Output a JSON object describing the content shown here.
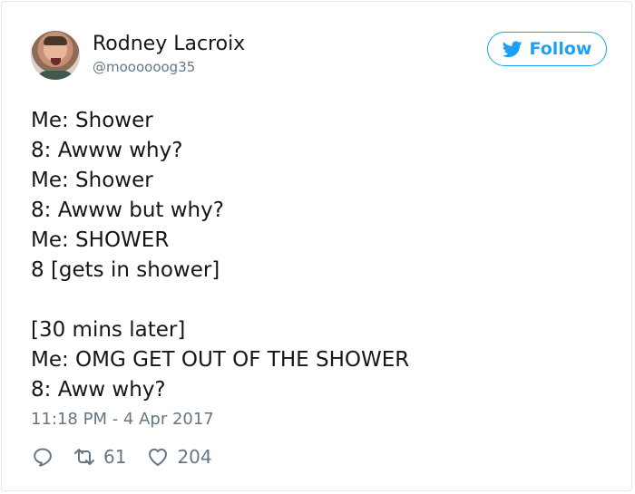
{
  "author": {
    "name": "Rodney Lacroix",
    "handle": "@moooooog35"
  },
  "follow_button": {
    "label": "Follow",
    "accent_color": "#1da1f2"
  },
  "tweet": {
    "lines": [
      "Me: Shower",
      "8: Awww why?",
      "Me: Shower",
      "8: Awww but why?",
      "Me: SHOWER",
      "8 [gets in shower]",
      "",
      "[30 mins later]",
      "Me: OMG GET OUT OF THE SHOWER",
      "8: Aww why?"
    ],
    "timestamp": "11:18 PM - 4 Apr 2017"
  },
  "actions": {
    "reply_icon": "reply-icon",
    "retweet_icon": "retweet-icon",
    "retweet_count": "61",
    "like_icon": "heart-icon",
    "like_count": "204"
  }
}
